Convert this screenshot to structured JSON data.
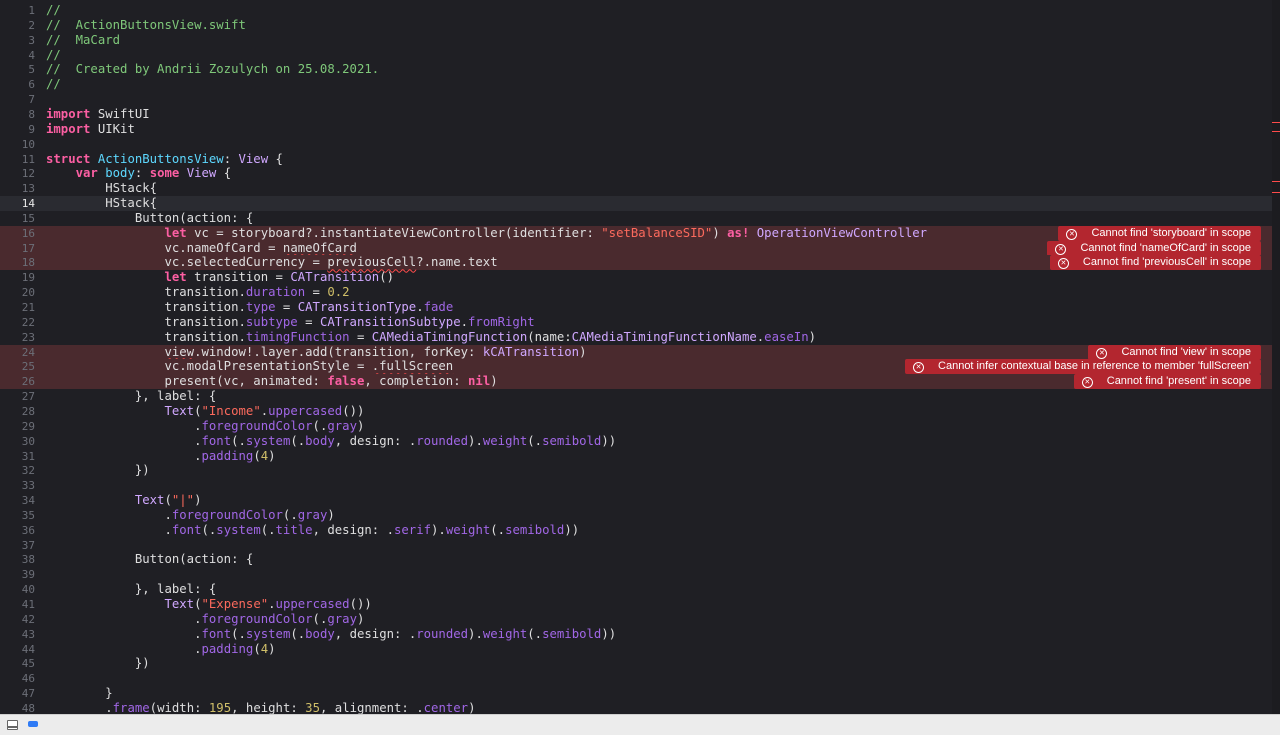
{
  "editor": {
    "current_line": 14,
    "lines": [
      {
        "n": 1,
        "tokens": [
          {
            "t": "//",
            "c": "comment"
          }
        ]
      },
      {
        "n": 2,
        "tokens": [
          {
            "t": "//  ActionButtonsView.swift",
            "c": "comment"
          }
        ]
      },
      {
        "n": 3,
        "tokens": [
          {
            "t": "//  MaCard",
            "c": "comment"
          }
        ]
      },
      {
        "n": 4,
        "tokens": [
          {
            "t": "//",
            "c": "comment"
          }
        ]
      },
      {
        "n": 5,
        "tokens": [
          {
            "t": "//  Created by Andrii Zozulych on 25.08.2021.",
            "c": "comment"
          }
        ]
      },
      {
        "n": 6,
        "tokens": [
          {
            "t": "//",
            "c": "comment"
          }
        ]
      },
      {
        "n": 7,
        "tokens": []
      },
      {
        "n": 8,
        "tokens": [
          {
            "t": "import",
            "c": "keyword"
          },
          {
            "t": " SwiftUI"
          }
        ]
      },
      {
        "n": 9,
        "tokens": [
          {
            "t": "import",
            "c": "keyword"
          },
          {
            "t": " UIKit"
          }
        ]
      },
      {
        "n": 10,
        "tokens": []
      },
      {
        "n": 11,
        "tokens": [
          {
            "t": "struct",
            "c": "keyword"
          },
          {
            "t": " "
          },
          {
            "t": "ActionButtonsView",
            "c": "decl"
          },
          {
            "t": ": "
          },
          {
            "t": "View",
            "c": "type"
          },
          {
            "t": " {"
          }
        ]
      },
      {
        "n": 12,
        "tokens": [
          {
            "t": "    "
          },
          {
            "t": "var",
            "c": "keyword"
          },
          {
            "t": " "
          },
          {
            "t": "body",
            "c": "decl"
          },
          {
            "t": ": "
          },
          {
            "t": "some",
            "c": "keyword"
          },
          {
            "t": " "
          },
          {
            "t": "View",
            "c": "type"
          },
          {
            "t": " {"
          }
        ]
      },
      {
        "n": 13,
        "tokens": [
          {
            "t": "        HStack{"
          }
        ]
      },
      {
        "n": 14,
        "tokens": [
          {
            "t": "        HStack{"
          }
        ]
      },
      {
        "n": 15,
        "tokens": [
          {
            "t": "            Button(action: {"
          }
        ]
      },
      {
        "n": 16,
        "error": "Cannot find 'storyboard' in scope",
        "tokens": [
          {
            "t": "                "
          },
          {
            "t": "let",
            "c": "keyword"
          },
          {
            "t": " vc = storyboard?.instantiateViewController(identifier: "
          },
          {
            "t": "\"setBalanceSID\"",
            "c": "string"
          },
          {
            "t": ") "
          },
          {
            "t": "as!",
            "c": "keyword"
          },
          {
            "t": " "
          },
          {
            "t": "OperationViewController",
            "c": "type"
          }
        ]
      },
      {
        "n": 17,
        "error": "Cannot find 'nameOfCard' in scope",
        "tokens": [
          {
            "t": "                vc.nameOfCard = "
          },
          {
            "t": "nameOfCard",
            "c": "squig"
          }
        ]
      },
      {
        "n": 18,
        "error": "Cannot find 'previousCell' in scope",
        "tokens": [
          {
            "t": "                vc.selectedCurrency = "
          },
          {
            "t": "previousCell",
            "c": "squig"
          },
          {
            "t": "?.name.text"
          }
        ]
      },
      {
        "n": 19,
        "tokens": [
          {
            "t": "                "
          },
          {
            "t": "let",
            "c": "keyword"
          },
          {
            "t": " transition = "
          },
          {
            "t": "CATransition",
            "c": "type"
          },
          {
            "t": "()"
          }
        ]
      },
      {
        "n": 20,
        "tokens": [
          {
            "t": "                transition."
          },
          {
            "t": "duration",
            "c": "prop"
          },
          {
            "t": " = "
          },
          {
            "t": "0.2",
            "c": "number"
          }
        ]
      },
      {
        "n": 21,
        "tokens": [
          {
            "t": "                transition."
          },
          {
            "t": "type",
            "c": "prop"
          },
          {
            "t": " = "
          },
          {
            "t": "CATransitionType",
            "c": "type"
          },
          {
            "t": "."
          },
          {
            "t": "fade",
            "c": "prop"
          }
        ]
      },
      {
        "n": 22,
        "tokens": [
          {
            "t": "                transition."
          },
          {
            "t": "subtype",
            "c": "prop"
          },
          {
            "t": " = "
          },
          {
            "t": "CATransitionSubtype",
            "c": "type"
          },
          {
            "t": "."
          },
          {
            "t": "fromRight",
            "c": "prop"
          }
        ]
      },
      {
        "n": 23,
        "tokens": [
          {
            "t": "                transition."
          },
          {
            "t": "timingFunction",
            "c": "prop"
          },
          {
            "t": " = "
          },
          {
            "t": "CAMediaTimingFunction",
            "c": "type"
          },
          {
            "t": "(name:"
          },
          {
            "t": "CAMediaTimingFunctionName",
            "c": "type"
          },
          {
            "t": "."
          },
          {
            "t": "easeIn",
            "c": "prop"
          },
          {
            "t": ")"
          }
        ]
      },
      {
        "n": 24,
        "error": "Cannot find 'view' in scope",
        "tokens": [
          {
            "t": "                "
          },
          {
            "t": "view",
            "c": "squig"
          },
          {
            "t": ".window!.layer.add(transition, forKey: "
          },
          {
            "t": "kCATransition",
            "c": "type"
          },
          {
            "t": ")"
          }
        ]
      },
      {
        "n": 25,
        "error": "Cannot infer contextual base in reference to member 'fullScreen'",
        "tokens": [
          {
            "t": "                vc.modalPresentationStyle = "
          },
          {
            "t": ".fullScreen",
            "c": "squig"
          }
        ]
      },
      {
        "n": 26,
        "error": "Cannot find 'present' in scope",
        "tokens": [
          {
            "t": "                present(vc, animated: "
          },
          {
            "t": "false",
            "c": "keyword"
          },
          {
            "t": ", completion: "
          },
          {
            "t": "nil",
            "c": "keyword"
          },
          {
            "t": ")"
          }
        ]
      },
      {
        "n": 27,
        "tokens": [
          {
            "t": "            }, label: {"
          }
        ]
      },
      {
        "n": 28,
        "tokens": [
          {
            "t": "                "
          },
          {
            "t": "Text",
            "c": "type"
          },
          {
            "t": "("
          },
          {
            "t": "\"Income\"",
            "c": "string"
          },
          {
            "t": "."
          },
          {
            "t": "uppercased",
            "c": "prop"
          },
          {
            "t": "())"
          }
        ]
      },
      {
        "n": 29,
        "tokens": [
          {
            "t": "                    ."
          },
          {
            "t": "foregroundColor",
            "c": "prop"
          },
          {
            "t": "(."
          },
          {
            "t": "gray",
            "c": "prop"
          },
          {
            "t": ")"
          }
        ]
      },
      {
        "n": 30,
        "tokens": [
          {
            "t": "                    ."
          },
          {
            "t": "font",
            "c": "prop"
          },
          {
            "t": "(."
          },
          {
            "t": "system",
            "c": "prop"
          },
          {
            "t": "(."
          },
          {
            "t": "body",
            "c": "prop"
          },
          {
            "t": ", design: ."
          },
          {
            "t": "rounded",
            "c": "prop"
          },
          {
            "t": ")."
          },
          {
            "t": "weight",
            "c": "prop"
          },
          {
            "t": "(."
          },
          {
            "t": "semibold",
            "c": "prop"
          },
          {
            "t": "))"
          }
        ]
      },
      {
        "n": 31,
        "tokens": [
          {
            "t": "                    ."
          },
          {
            "t": "padding",
            "c": "prop"
          },
          {
            "t": "("
          },
          {
            "t": "4",
            "c": "number"
          },
          {
            "t": ")"
          }
        ]
      },
      {
        "n": 32,
        "tokens": [
          {
            "t": "            })"
          }
        ]
      },
      {
        "n": 33,
        "tokens": []
      },
      {
        "n": 34,
        "tokens": [
          {
            "t": "            "
          },
          {
            "t": "Text",
            "c": "type"
          },
          {
            "t": "("
          },
          {
            "t": "\"|\"",
            "c": "string"
          },
          {
            "t": ")"
          }
        ]
      },
      {
        "n": 35,
        "tokens": [
          {
            "t": "                ."
          },
          {
            "t": "foregroundColor",
            "c": "prop"
          },
          {
            "t": "(."
          },
          {
            "t": "gray",
            "c": "prop"
          },
          {
            "t": ")"
          }
        ]
      },
      {
        "n": 36,
        "tokens": [
          {
            "t": "                ."
          },
          {
            "t": "font",
            "c": "prop"
          },
          {
            "t": "(."
          },
          {
            "t": "system",
            "c": "prop"
          },
          {
            "t": "(."
          },
          {
            "t": "title",
            "c": "prop"
          },
          {
            "t": ", design: ."
          },
          {
            "t": "serif",
            "c": "prop"
          },
          {
            "t": ")."
          },
          {
            "t": "weight",
            "c": "prop"
          },
          {
            "t": "(."
          },
          {
            "t": "semibold",
            "c": "prop"
          },
          {
            "t": "))"
          }
        ]
      },
      {
        "n": 37,
        "tokens": []
      },
      {
        "n": 38,
        "tokens": [
          {
            "t": "            Button(action: {"
          }
        ]
      },
      {
        "n": 39,
        "tokens": []
      },
      {
        "n": 40,
        "tokens": [
          {
            "t": "            }, label: {"
          }
        ]
      },
      {
        "n": 41,
        "tokens": [
          {
            "t": "                "
          },
          {
            "t": "Text",
            "c": "type"
          },
          {
            "t": "("
          },
          {
            "t": "\"Expense\"",
            "c": "string"
          },
          {
            "t": "."
          },
          {
            "t": "uppercased",
            "c": "prop"
          },
          {
            "t": "())"
          }
        ]
      },
      {
        "n": 42,
        "tokens": [
          {
            "t": "                    ."
          },
          {
            "t": "foregroundColor",
            "c": "prop"
          },
          {
            "t": "(."
          },
          {
            "t": "gray",
            "c": "prop"
          },
          {
            "t": ")"
          }
        ]
      },
      {
        "n": 43,
        "tokens": [
          {
            "t": "                    ."
          },
          {
            "t": "font",
            "c": "prop"
          },
          {
            "t": "(."
          },
          {
            "t": "system",
            "c": "prop"
          },
          {
            "t": "(."
          },
          {
            "t": "body",
            "c": "prop"
          },
          {
            "t": ", design: ."
          },
          {
            "t": "rounded",
            "c": "prop"
          },
          {
            "t": ")."
          },
          {
            "t": "weight",
            "c": "prop"
          },
          {
            "t": "(."
          },
          {
            "t": "semibold",
            "c": "prop"
          },
          {
            "t": "))"
          }
        ]
      },
      {
        "n": 44,
        "tokens": [
          {
            "t": "                    ."
          },
          {
            "t": "padding",
            "c": "prop"
          },
          {
            "t": "("
          },
          {
            "t": "4",
            "c": "number"
          },
          {
            "t": ")"
          }
        ]
      },
      {
        "n": 45,
        "tokens": [
          {
            "t": "            })"
          }
        ]
      },
      {
        "n": 46,
        "tokens": []
      },
      {
        "n": 47,
        "tokens": [
          {
            "t": "        }"
          }
        ]
      },
      {
        "n": 48,
        "tokens": [
          {
            "t": "        ."
          },
          {
            "t": "frame",
            "c": "prop"
          },
          {
            "t": "(width: "
          },
          {
            "t": "195",
            "c": "number"
          },
          {
            "t": ", height: "
          },
          {
            "t": "35",
            "c": "number"
          },
          {
            "t": ", alignment: ."
          },
          {
            "t": "center",
            "c": "prop"
          },
          {
            "t": ")"
          }
        ]
      }
    ]
  },
  "icons": {
    "error": "error-circle-x-icon",
    "console": "console-toggle-icon",
    "debug": "debug-area-toggle-icon"
  },
  "colors": {
    "background": "#1f1f24",
    "error_line": "#4a2a2e",
    "error_badge": "#b3262f",
    "keyword": "#fc5fa3",
    "string": "#fc6a5d",
    "comment": "#7fc87a",
    "type": "#d0a8ff",
    "number": "#d0bf69"
  }
}
